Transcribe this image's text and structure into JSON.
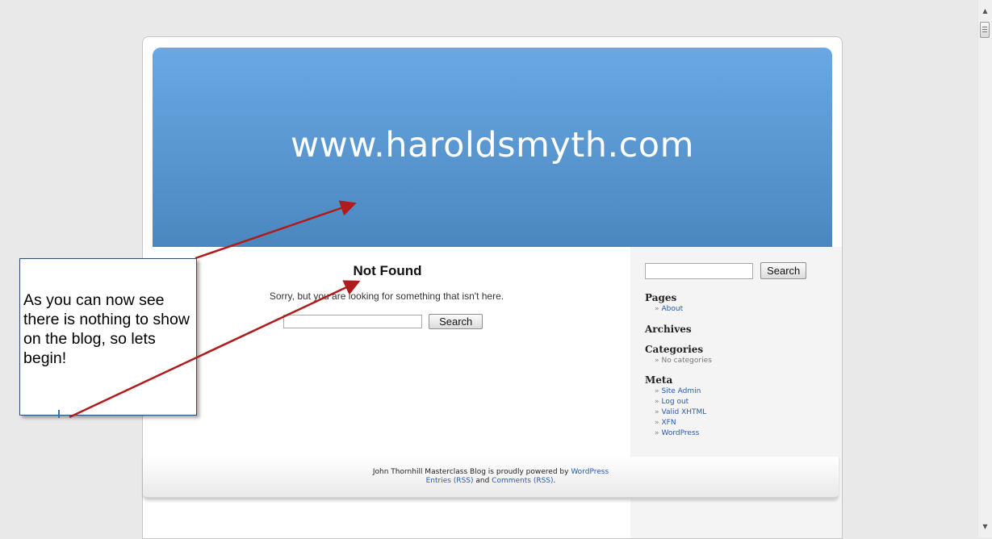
{
  "header": {
    "site_title": "www.haroldsmyth.com"
  },
  "main": {
    "heading": "Not Found",
    "message": "Sorry, but you are looking for something that isn't here.",
    "search_button": "Search"
  },
  "sidebar": {
    "search_button": "Search",
    "sections": [
      {
        "title": "Pages",
        "items": [
          "About"
        ]
      },
      {
        "title": "Archives",
        "items": []
      },
      {
        "title": "Categories",
        "items": [
          "No categories"
        ]
      },
      {
        "title": "Meta",
        "items": [
          "Site Admin",
          "Log out",
          "Valid XHTML",
          "XFN",
          "WordPress"
        ]
      }
    ]
  },
  "footer": {
    "line1_prefix": "John Thornhill Masterclass Blog is proudly powered by ",
    "line1_link": "WordPress",
    "entries_link": "Entries (RSS)",
    "and": " and ",
    "comments_link": "Comments (RSS)",
    "end": "."
  },
  "callout": {
    "text": "As you can now see there is nothing to show on the blog, so lets begin!"
  },
  "colors": {
    "header_top": "#69a8e4",
    "header_bottom": "#4b87bf",
    "arrow": "#b01c1c",
    "link": "#2a5aa8"
  }
}
